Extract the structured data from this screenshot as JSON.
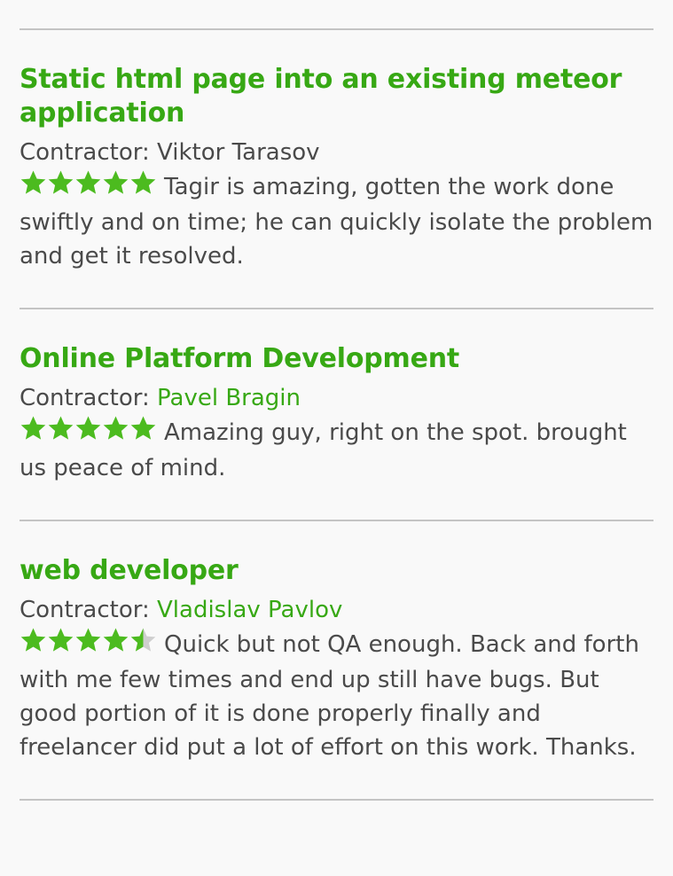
{
  "reviews": [
    {
      "title": "Static html page into an existing meteor application",
      "contractor_label": "Contractor:",
      "contractor_name": "Viktor Tarasov",
      "contractor_is_link": false,
      "rating": 5,
      "feedback": "Tagir is amazing, gotten the work done swiftly and on time; he can quickly isolate the problem and get it resolved."
    },
    {
      "title": "Online Platform Development",
      "contractor_label": "Contractor:",
      "contractor_name": "Pavel Bragin",
      "contractor_is_link": true,
      "rating": 5,
      "feedback": "Amazing guy, right on the spot. brought us peace of mind."
    },
    {
      "title": "web developer",
      "contractor_label": "Contractor:",
      "contractor_name": "Vladislav Pavlov",
      "contractor_is_link": true,
      "rating": 4.5,
      "feedback": "Quick but not QA enough. Back and forth with me few times and end up still have bugs. But good portion of it is done properly finally and freelancer did put a lot of effort on this work. Thanks."
    }
  ],
  "colors": {
    "accent": "#37a814",
    "star_filled": "#4cbb1f",
    "star_empty": "#cfcfcf",
    "text": "#4a4a4a",
    "divider": "#c4c4c4"
  },
  "icons": {
    "star": "star-icon",
    "half_star": "half-star-icon"
  }
}
